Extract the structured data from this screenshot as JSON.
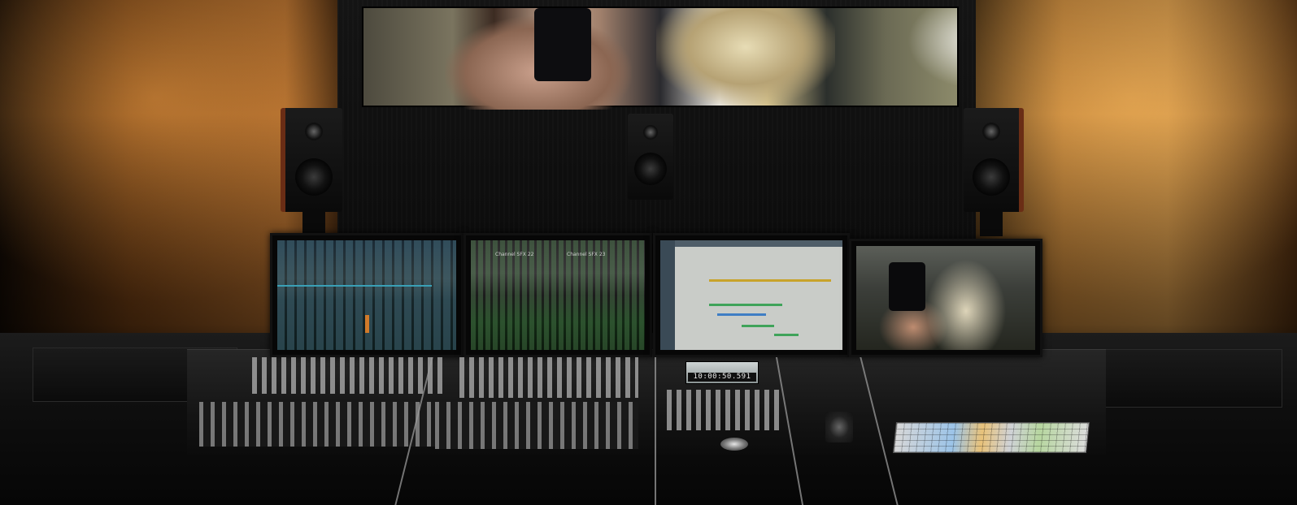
{
  "scene": {
    "description_label": "",
    "timecode_display": "10:00:50.591",
    "channel_labels": [
      "Channel  SFX 22",
      "Channel  SFX 23"
    ]
  }
}
